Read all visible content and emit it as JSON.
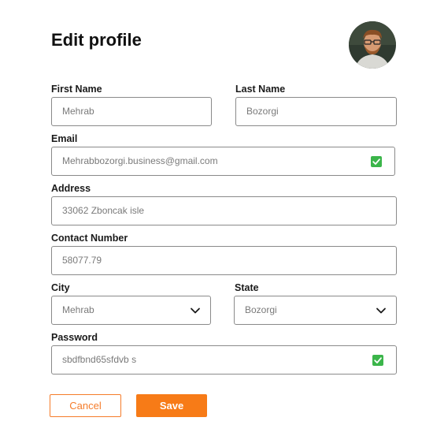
{
  "page": {
    "title": "Edit profile"
  },
  "avatar": {
    "icon": "user-avatar-photo"
  },
  "form": {
    "first_name": {
      "label": "First Name",
      "value": "Mehrab"
    },
    "last_name": {
      "label": "Last Name",
      "value": "Bozorgi"
    },
    "email": {
      "label": "Email",
      "value": "Mehrabbozorgi.business@gmail.com",
      "verified": true
    },
    "address": {
      "label": "Address",
      "value": "33062 Zboncak isle"
    },
    "contact_number": {
      "label": "Contact Number",
      "value": "58077.79"
    },
    "city": {
      "label": "City",
      "value": "Mehrab"
    },
    "state": {
      "label": "State",
      "value": "Bozorgi"
    },
    "password": {
      "label": "Password",
      "value": "sbdfbnd65sfdvb s",
      "valid": true
    }
  },
  "actions": {
    "cancel_label": "Cancel",
    "save_label": "Save"
  },
  "colors": {
    "accent": "#f77b17",
    "check": "#3bb54a",
    "border": "#8a8a8a"
  }
}
